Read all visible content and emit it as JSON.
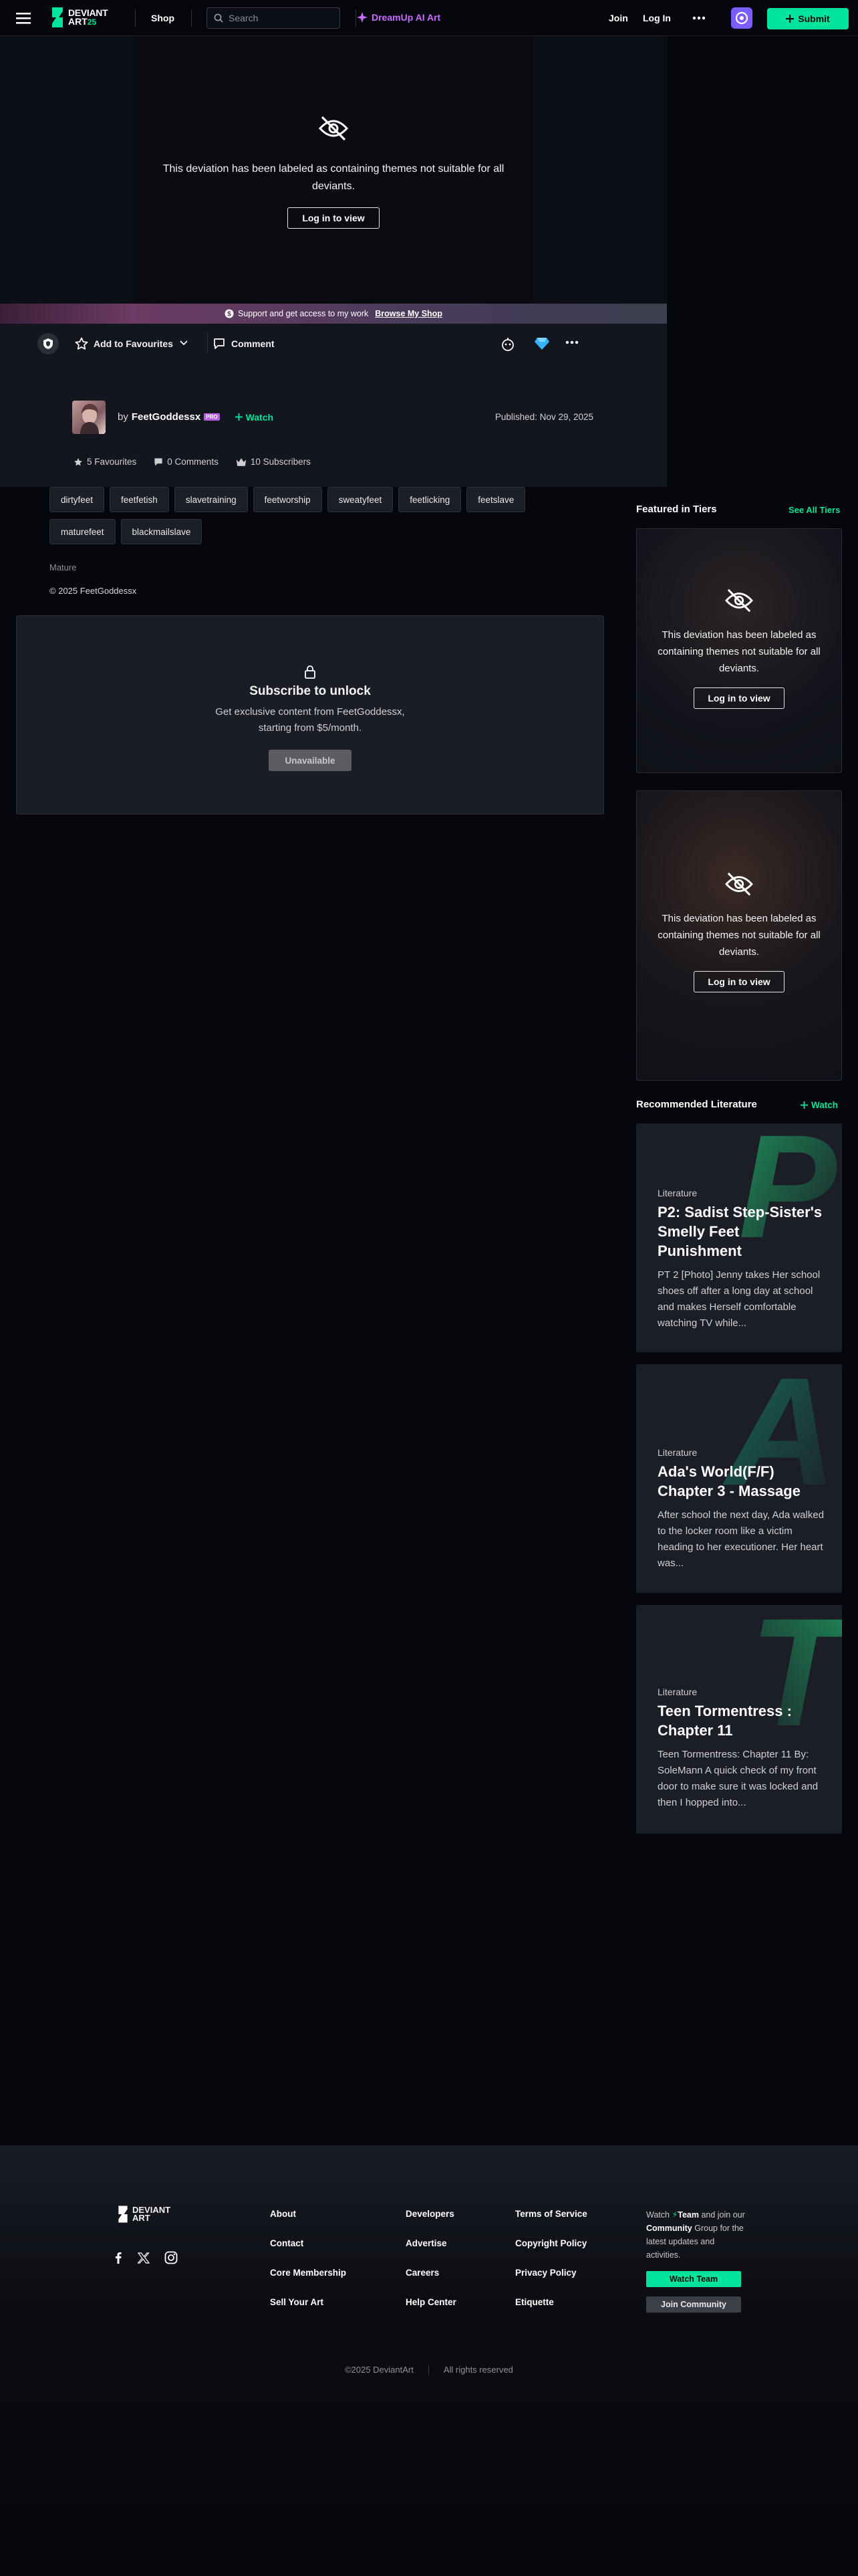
{
  "nav": {
    "shop": "Shop",
    "search_placeholder": "Search",
    "dreamup": "DreamUp AI Art",
    "join": "Join",
    "login": "Log In",
    "submit": "Submit",
    "logo_main": "DEVIANT",
    "logo_sub": "ART",
    "logo_num": "25"
  },
  "deviation": {
    "locked_message": "This deviation has been labeled as containing themes not suitable for all deviants.",
    "login_label": "Log in to view"
  },
  "support": {
    "text": "Support and get access to my work",
    "link": "Browse My Shop"
  },
  "actions": {
    "favourite": "Add to Favourites",
    "comment": "Comment"
  },
  "author": {
    "by": "by",
    "name": "FeetGoddessx",
    "badge": "PRO",
    "watch": "Watch",
    "published": "Published: Nov 29, 2025"
  },
  "stats": {
    "favourites": "5 Favourites",
    "comments": "0 Comments",
    "subscribers": "10 Subscribers"
  },
  "tags": [
    "dirtyfeet",
    "feetfetish",
    "slavetraining",
    "feetworship",
    "sweatyfeet",
    "feetlicking",
    "feetslave",
    "maturefeet",
    "blackmailslave"
  ],
  "meta": {
    "rating": "Mature",
    "copyright": "© 2025 FeetGoddessx"
  },
  "subscribe": {
    "title": "Subscribe to unlock",
    "desc_line1": "Get exclusive content from FeetGoddessx,",
    "desc_line2": "starting from $5/month.",
    "button": "Unavailable"
  },
  "tiers": {
    "title": "Featured in Tiers",
    "see_all": "See All Tiers",
    "cards": [
      {
        "message": "This deviation has been labeled as containing themes not suitable for all deviants.",
        "login": "Log in to view"
      },
      {
        "message": "This deviation has been labeled as containing themes not suitable for all deviants.",
        "login": "Log in to view"
      }
    ]
  },
  "literature": {
    "title": "Recommended Literature",
    "watch": "Watch",
    "items": [
      {
        "kicker": "Literature",
        "title": "P2: Sadist Step-Sister's Smelly Feet Punishment",
        "excerpt": "PT 2 [Photo] Jenny takes Her school shoes off after a long day at school and makes Herself comfortable watching TV while...",
        "letter": "P",
        "accent": "#1e8f5a"
      },
      {
        "kicker": "Literature",
        "title": "Ada's World(F/F) Chapter 3 - Massage",
        "excerpt": "After school the next day, Ada walked to the locker room like a victim heading to her executioner. Her heart was...",
        "letter": "A",
        "accent": "#1a6b5b"
      },
      {
        "kicker": "Literature",
        "title": "Teen Tormentress : Chapter 11",
        "excerpt": "Teen Tormentress: Chapter 11 By: SoleMann A quick check of my front door to make sure it was locked and then I hopped into...",
        "letter": "T",
        "accent": "#1e8f5a"
      }
    ]
  },
  "footer": {
    "col1": [
      "About",
      "Contact",
      "Core Membership",
      "Sell Your Art"
    ],
    "col2": [
      "Developers",
      "Advertise",
      "Careers",
      "Help Center"
    ],
    "col3": [
      "Terms of Service",
      "Copyright Policy",
      "Privacy Policy",
      "Etiquette"
    ],
    "team_text_1": "Watch",
    "team_name": "Team",
    "team_text_2": "and join our",
    "community": "Community",
    "team_text_3": "Group for the latest updates and activities.",
    "watch_team": "Watch Team",
    "join_community": "Join Community",
    "copyright": "©2025 DeviantArt",
    "rights": "All rights reserved"
  },
  "colors": {
    "accent": "#00e59b",
    "dreamup": "#c66cff",
    "pro_badge": "#b661e0",
    "bg": "#06070d"
  }
}
